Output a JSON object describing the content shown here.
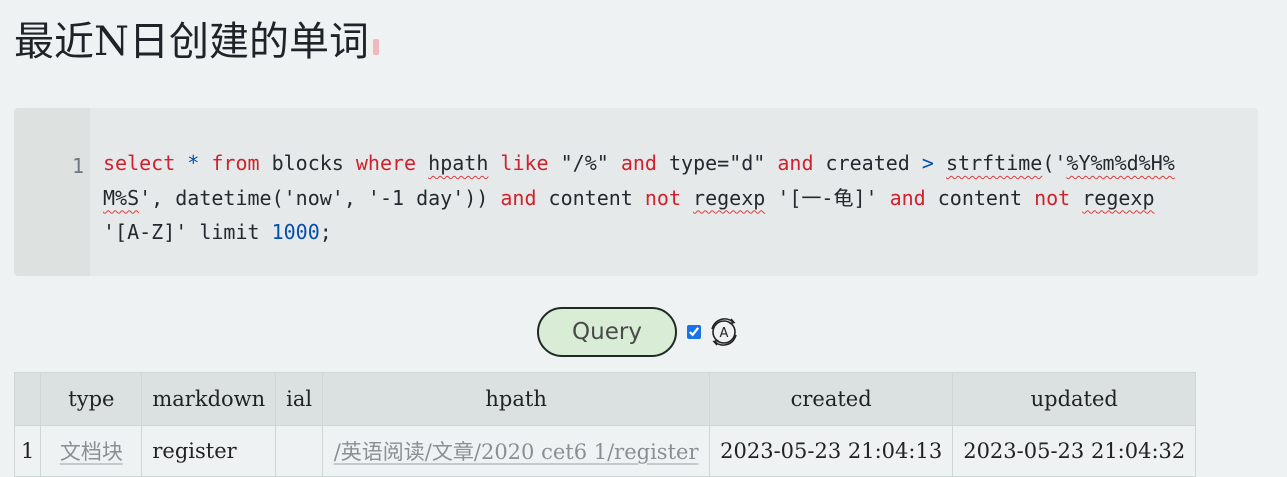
{
  "title": "最近N日创建的单词",
  "code": {
    "line_number": "1",
    "tokens": [
      [
        {
          "t": "select",
          "c": "kw"
        },
        {
          "t": " ",
          "c": ""
        },
        {
          "t": "*",
          "c": "op"
        },
        {
          "t": " ",
          "c": ""
        },
        {
          "t": "from",
          "c": "kw"
        },
        {
          "t": " blocks ",
          "c": ""
        },
        {
          "t": "where",
          "c": "kw"
        },
        {
          "t": " ",
          "c": ""
        },
        {
          "t": "hpath",
          "c": "spell"
        },
        {
          "t": " ",
          "c": ""
        },
        {
          "t": "like",
          "c": "kw"
        },
        {
          "t": " \"/%\" ",
          "c": ""
        },
        {
          "t": "and",
          "c": "kw"
        },
        {
          "t": " type=\"d\" ",
          "c": ""
        },
        {
          "t": "and",
          "c": "kw"
        },
        {
          "t": " created ",
          "c": ""
        },
        {
          "t": ">",
          "c": "op"
        },
        {
          "t": " ",
          "c": ""
        },
        {
          "t": "strftime",
          "c": "spell"
        },
        {
          "t": "('",
          "c": ""
        },
        {
          "t": "%Y%m%d%H%",
          "c": "spell"
        }
      ],
      [
        {
          "t": "M%S",
          "c": "spell"
        },
        {
          "t": "', datetime('now', '-1 day')) ",
          "c": ""
        },
        {
          "t": "and",
          "c": "kw"
        },
        {
          "t": " content ",
          "c": ""
        },
        {
          "t": "not",
          "c": "kw"
        },
        {
          "t": " ",
          "c": ""
        },
        {
          "t": "regexp",
          "c": "spell"
        },
        {
          "t": " '[一-龟]' ",
          "c": ""
        },
        {
          "t": "and",
          "c": "kw"
        },
        {
          "t": " content ",
          "c": ""
        },
        {
          "t": "not",
          "c": "kw"
        },
        {
          "t": " ",
          "c": ""
        },
        {
          "t": "regexp",
          "c": "spell"
        }
      ],
      [
        {
          "t": "'[A-Z]' limit ",
          "c": ""
        },
        {
          "t": "1000",
          "c": "num"
        },
        {
          "t": ";",
          "c": ""
        }
      ]
    ]
  },
  "query_button": "Query",
  "auto_checkbox_checked": true,
  "auto_icon": "auto-refresh-icon",
  "table": {
    "headers": [
      "",
      "type",
      "markdown",
      "ial",
      "hpath",
      "created",
      "updated"
    ],
    "rows": [
      {
        "index": "1",
        "type": "文档块",
        "markdown": "register",
        "ial": "",
        "hpath": "/英语阅读/文章/2020 cet6 1/register",
        "created": "2023-05-23 21:04:13",
        "updated": "2023-05-23 21:04:32"
      }
    ]
  },
  "colors": {
    "keyword": "#cf222e",
    "operator": "#0550ae",
    "button_bg": "#d8ecd6",
    "checkbox": "#1a73e8"
  }
}
